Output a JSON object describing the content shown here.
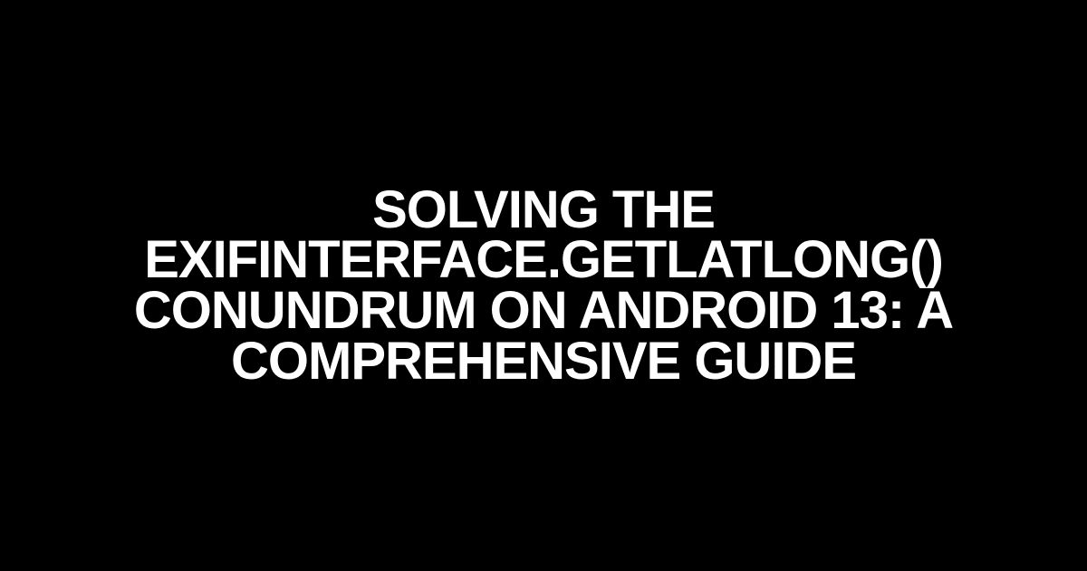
{
  "title": "SOLVING THE EXIFINTERFACE.GETLATLONG() CONUNDRUM ON ANDROID 13: A COMPREHENSIVE GUIDE"
}
